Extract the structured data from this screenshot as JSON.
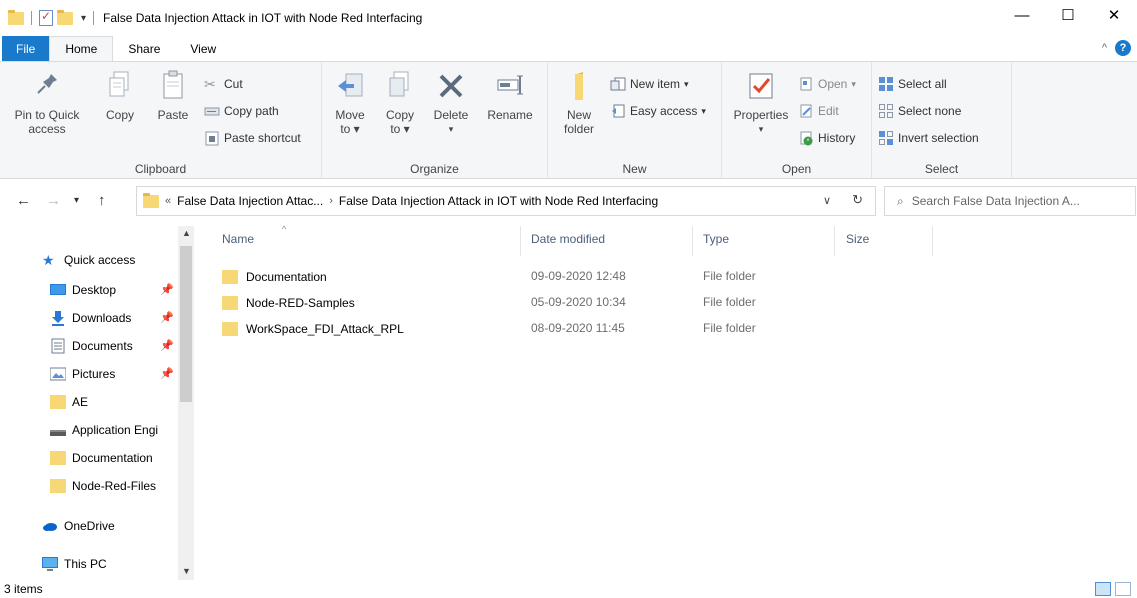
{
  "titlebar": {
    "title": "False Data Injection Attack in IOT with Node Red Interfacing",
    "minimize": "—",
    "maximize": "☐",
    "close": "✕"
  },
  "tabs": [
    "File",
    "Home",
    "Share",
    "View"
  ],
  "ribbon": {
    "clipboard": {
      "label": "Clipboard",
      "pin": "Pin to Quick access",
      "pin_l1": "Pin to Quick",
      "pin_l2": "access",
      "copy": "Copy",
      "paste": "Paste",
      "cut": "Cut",
      "copy_path": "Copy path",
      "paste_shortcut": "Paste shortcut"
    },
    "organize": {
      "label": "Organize",
      "move_to": "Move",
      "move_to2": "to",
      "copy_to": "Copy",
      "copy_to2": "to",
      "delete": "Delete",
      "rename": "Rename"
    },
    "new": {
      "label": "New",
      "new_folder1": "New",
      "new_folder2": "folder",
      "new_item": "New item",
      "easy_access": "Easy access"
    },
    "open": {
      "label": "Open",
      "properties": "Properties",
      "open": "Open",
      "edit": "Edit",
      "history": "History"
    },
    "select": {
      "label": "Select",
      "select_all": "Select all",
      "select_none": "Select none",
      "invert": "Invert selection"
    }
  },
  "address": {
    "crumb1": "False Data Injection Attac...",
    "crumb2": "False Data Injection Attack in IOT with Node Red Interfacing",
    "search_placeholder": "Search False Data Injection A..."
  },
  "nav": {
    "items": [
      {
        "label": "Quick access",
        "icon": "star-icon"
      },
      {
        "label": "Desktop",
        "icon": "desktop-icon",
        "pinned": true
      },
      {
        "label": "Downloads",
        "icon": "download-icon",
        "pinned": true
      },
      {
        "label": "Documents",
        "icon": "documents-icon",
        "pinned": true
      },
      {
        "label": "Pictures",
        "icon": "pictures-icon",
        "pinned": true
      },
      {
        "label": "AE",
        "icon": "folder-icon"
      },
      {
        "label": "Application Engi",
        "icon": "drive-icon"
      },
      {
        "label": "Documentation",
        "icon": "folder-icon"
      },
      {
        "label": "Node-Red-Files",
        "icon": "folder-icon"
      },
      {
        "label": "OneDrive",
        "icon": "cloud-icon"
      },
      {
        "label": "This PC",
        "icon": "computer-icon"
      }
    ]
  },
  "columns": {
    "name": "Name",
    "date": "Date modified",
    "type": "Type",
    "size": "Size"
  },
  "files": [
    {
      "name": "Documentation",
      "date": "09-09-2020 12:48",
      "type": "File folder"
    },
    {
      "name": "Node-RED-Samples",
      "date": "05-09-2020 10:34",
      "type": "File folder"
    },
    {
      "name": "WorkSpace_FDI_Attack_RPL",
      "date": "08-09-2020 11:45",
      "type": "File folder"
    }
  ],
  "status": {
    "count": "3 items"
  },
  "colors": {
    "accent": "#1979ca",
    "folder": "#f8d775"
  }
}
